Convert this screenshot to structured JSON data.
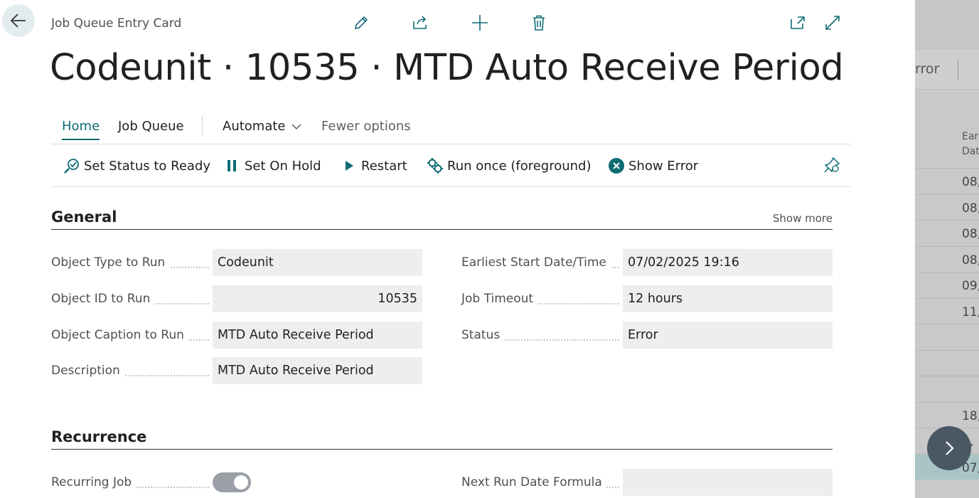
{
  "background": {
    "header_partial": "rror",
    "column_header_partial": [
      "Ear",
      "Dat"
    ],
    "rows": [
      "08,",
      "08,",
      "08,",
      "08,",
      "09,",
      "11,",
      "",
      "",
      "",
      "18,",
      "8,",
      "07,"
    ]
  },
  "card": {
    "breadcrumb": "Job Queue Entry Card",
    "title": "Codeunit · 10535 · MTD Auto Receive Period",
    "tabs": {
      "home": "Home",
      "job_queue": "Job Queue",
      "automate": "Automate",
      "fewer_options": "Fewer options"
    },
    "actions": {
      "set_status_ready": "Set Status to Ready",
      "set_on_hold": "Set On Hold",
      "restart": "Restart",
      "run_once": "Run once (foreground)",
      "show_error": "Show Error"
    },
    "general": {
      "heading": "General",
      "show_more": "Show more",
      "object_type_label": "Object Type to Run",
      "object_type_value": "Codeunit",
      "object_id_label": "Object ID to Run",
      "object_id_value": "10535",
      "object_caption_label": "Object Caption to Run",
      "object_caption_value": "MTD Auto Receive Period",
      "description_label": "Description",
      "description_value": "MTD Auto Receive Period",
      "earliest_start_label": "Earliest Start Date/Time",
      "earliest_start_value": "07/02/2025 19:16",
      "job_timeout_label": "Job Timeout",
      "job_timeout_value": "12 hours",
      "status_label": "Status",
      "status_value": "Error"
    },
    "recurrence": {
      "heading": "Recurrence",
      "recurring_job_label": "Recurring Job",
      "recurring_job_on": true,
      "next_run_formula_label": "Next Run Date Formula",
      "next_run_formula_value": ""
    }
  },
  "colors": {
    "accent": "#0e6c74",
    "field_bg": "#edeeef",
    "overlay": "#c9c9c9",
    "next_button": "#4a5866"
  },
  "icons": [
    "back-arrow-icon",
    "edit-pencil-icon",
    "share-icon",
    "plus-icon",
    "trash-icon",
    "open-new-window-icon",
    "expand-icon",
    "set-ready-icon",
    "pause-icon",
    "play-icon",
    "run-once-icon",
    "error-x-icon",
    "pin-icon",
    "chevron-down-icon",
    "chevron-right-icon"
  ]
}
